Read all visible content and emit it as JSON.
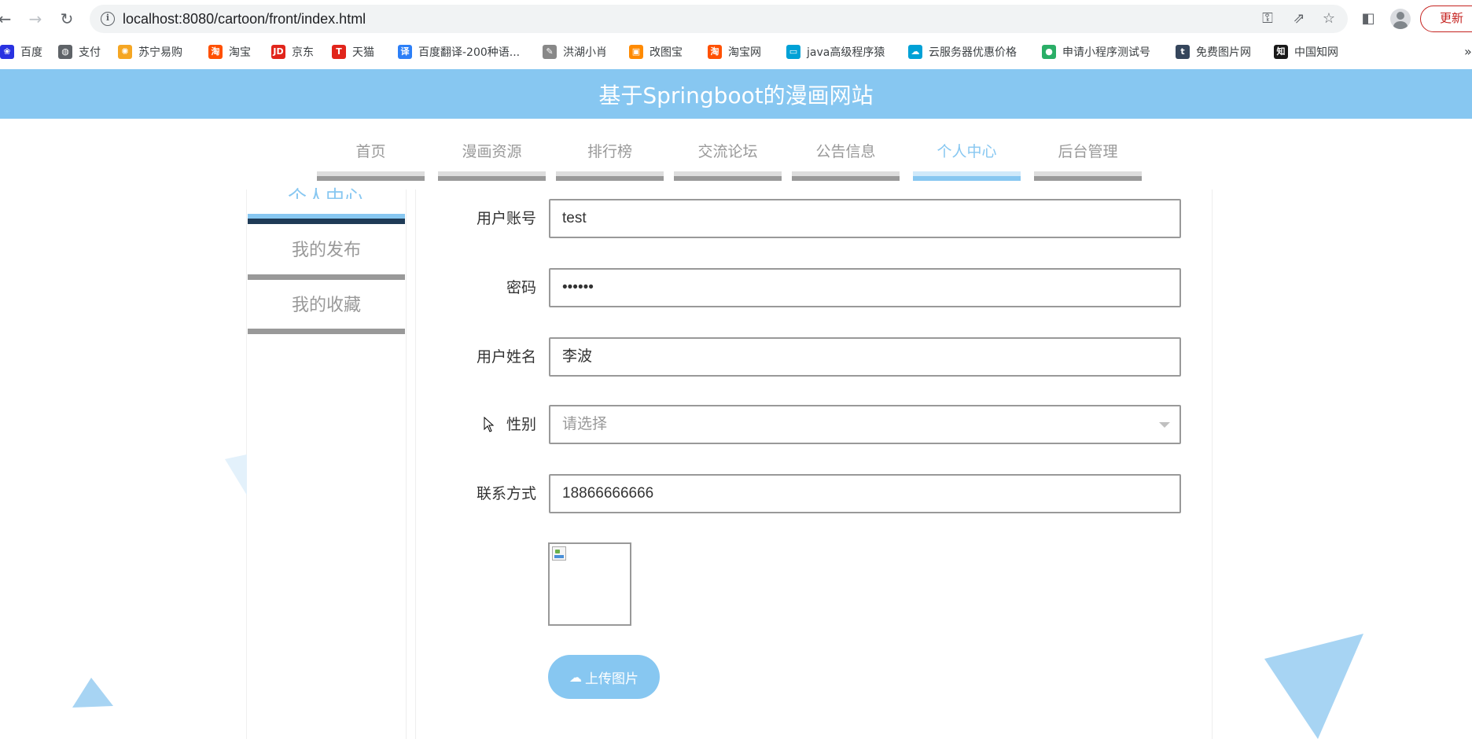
{
  "browser": {
    "url": "localhost:8080/cartoon/front/index.html",
    "update_label": "更新",
    "bookmarks": [
      {
        "label": "百度",
        "icon": "paw-icon",
        "color": "#2932e1"
      },
      {
        "label": "支付",
        "icon": "globe-icon",
        "color": "#5f6368"
      },
      {
        "label": "苏宁易购",
        "icon": "lion-icon",
        "color": "#f5a623"
      },
      {
        "label": "淘宝",
        "icon": "taobao-icon",
        "color": "#ff5000"
      },
      {
        "label": "京东",
        "icon": "jd-icon",
        "color": "#e1251b"
      },
      {
        "label": "天猫",
        "icon": "tmall-icon",
        "color": "#e1251b"
      },
      {
        "label": "百度翻译-200种语...",
        "icon": "translate-icon",
        "color": "#2c7ff7"
      },
      {
        "label": "洪湖小肖",
        "icon": "feather-icon",
        "color": "#888888"
      },
      {
        "label": "改图宝",
        "icon": "gaitubao-icon",
        "color": "#ff8a00"
      },
      {
        "label": "淘宝网",
        "icon": "taobao-icon",
        "color": "#ff5000"
      },
      {
        "label": "java高级程序猿",
        "icon": "bilibili-icon",
        "color": "#00a1d6"
      },
      {
        "label": "云服务器优惠价格",
        "icon": "cloud-icon",
        "color": "#00a1d6"
      },
      {
        "label": "申请小程序测试号",
        "icon": "wechat-icon",
        "color": "#2aae67"
      },
      {
        "label": "免费图片网",
        "icon": "tumblr-icon",
        "color": "#35465c"
      },
      {
        "label": "中国知网",
        "icon": "cnki-icon",
        "color": "#1a1a1a"
      }
    ],
    "more_label": "»"
  },
  "site": {
    "title": "基于Springboot的漫画网站"
  },
  "nav": {
    "items": [
      {
        "label": "首页"
      },
      {
        "label": "漫画资源"
      },
      {
        "label": "排行榜"
      },
      {
        "label": "交流论坛"
      },
      {
        "label": "公告信息"
      },
      {
        "label": "个人中心"
      },
      {
        "label": "后台管理"
      }
    ],
    "active": "个人中心"
  },
  "sidebar": {
    "title": "个人中心",
    "items": [
      {
        "label": "我的发布"
      },
      {
        "label": "我的收藏"
      }
    ]
  },
  "form": {
    "account": {
      "label": "用户账号",
      "value": "test"
    },
    "password": {
      "label": "密码",
      "value": "••••••"
    },
    "name": {
      "label": "用户姓名",
      "value": "李波"
    },
    "gender": {
      "label": "性别",
      "placeholder": "请选择"
    },
    "phone": {
      "label": "联系方式",
      "value": "18866666666"
    },
    "upload_label": "上传图片"
  },
  "colors": {
    "accent": "#87c7f1",
    "nav_inactive": "#999999",
    "sidebar_dark": "#1f3b57"
  }
}
